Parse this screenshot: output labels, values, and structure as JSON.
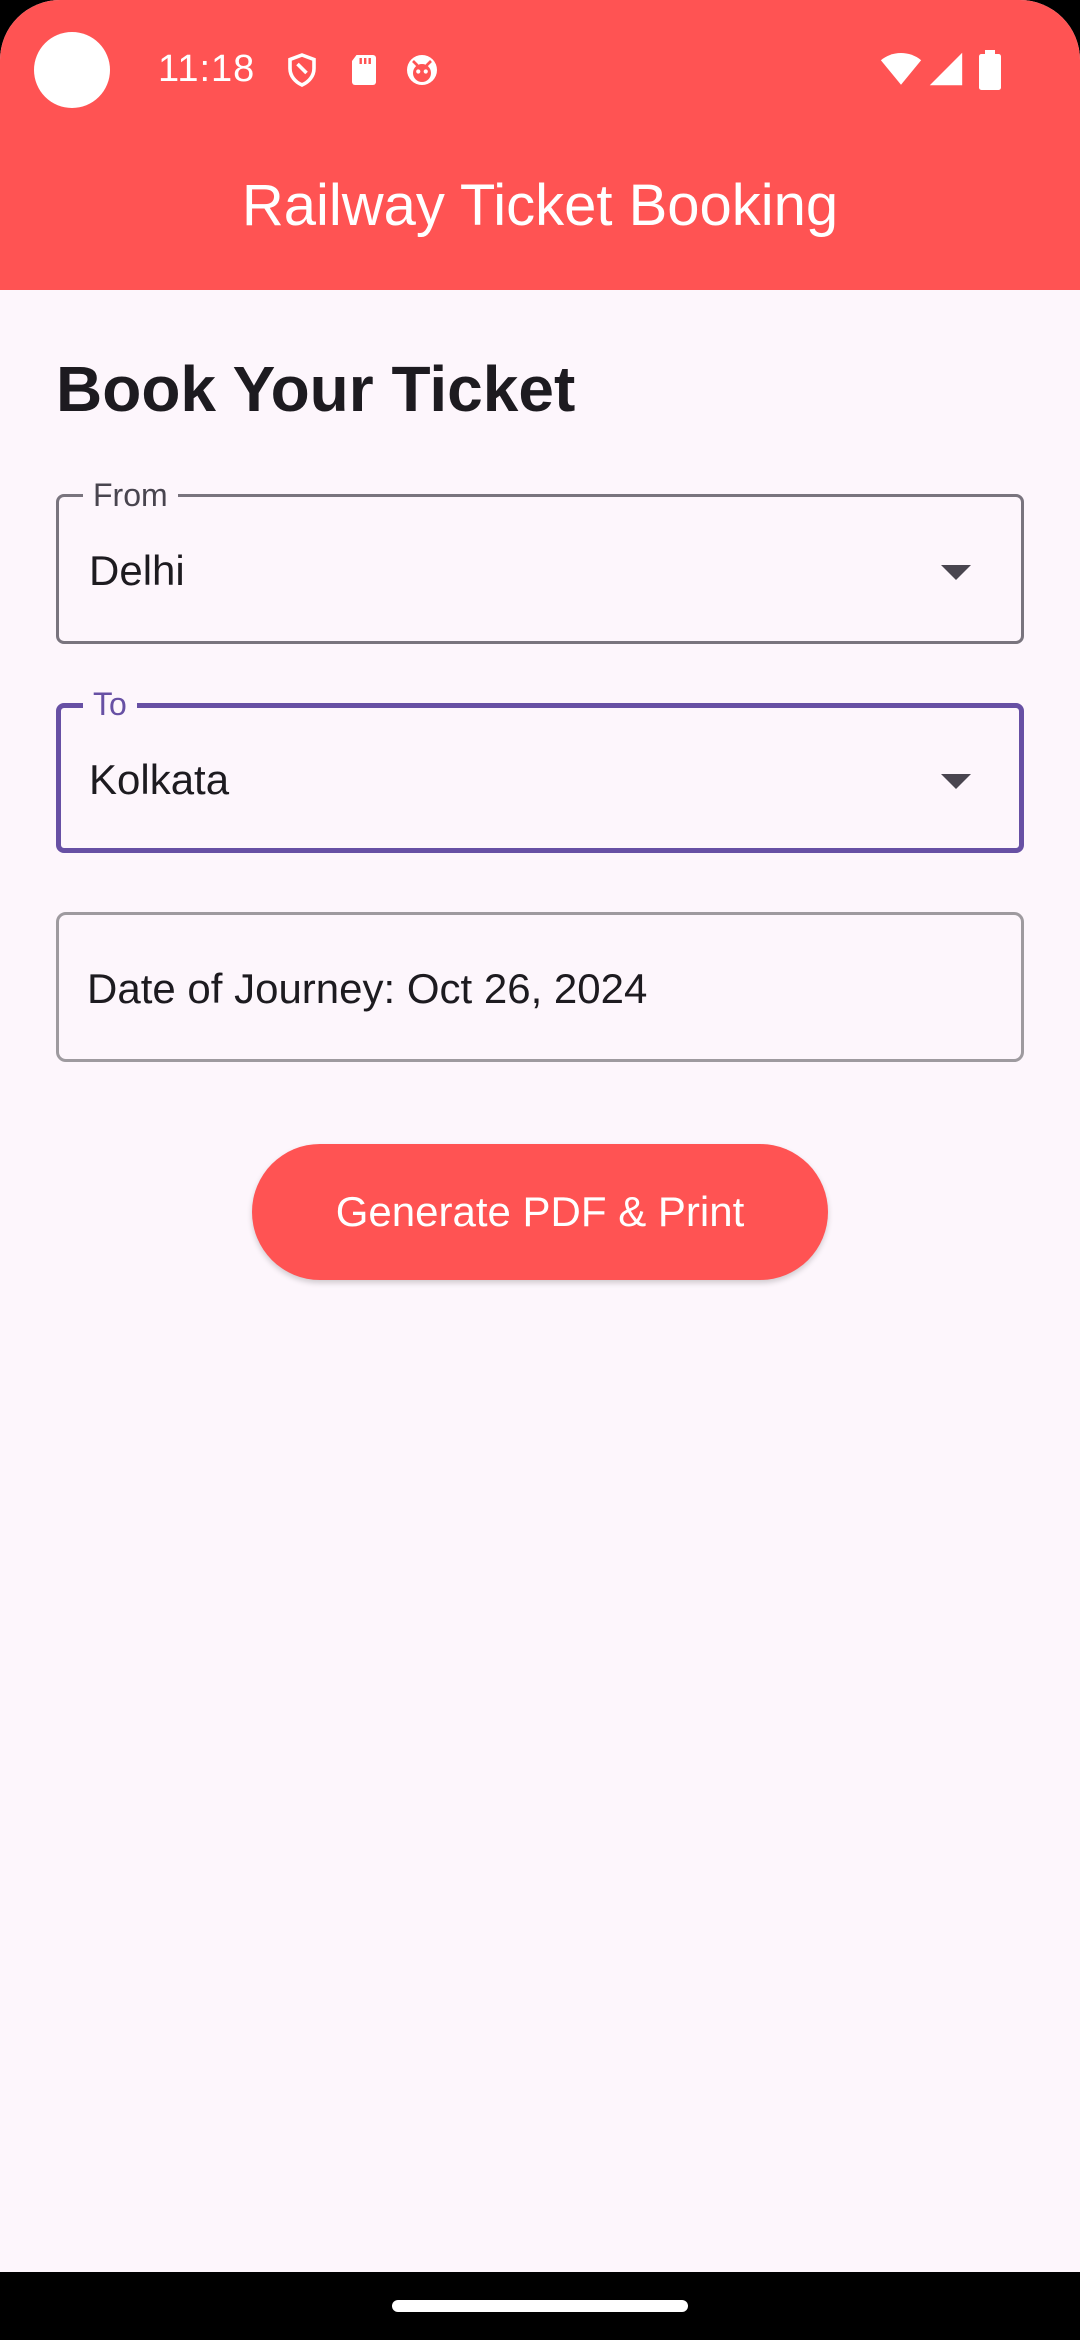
{
  "status_bar": {
    "time": "11:18",
    "left_icons": [
      "shield-icon",
      "sd-card-icon",
      "face-icon"
    ],
    "right_icons": [
      "wifi-icon",
      "signal-icon",
      "battery-icon"
    ]
  },
  "app_bar": {
    "title": "Railway Ticket Booking",
    "color": "#FF5353"
  },
  "form": {
    "heading": "Book Your Ticket",
    "from": {
      "label": "From",
      "value": "Delhi"
    },
    "to": {
      "label": "To",
      "value": "Kolkata"
    },
    "date_field": {
      "text": "Date of Journey: Oct 26, 2024"
    },
    "submit_label": "Generate PDF & Print"
  },
  "colors": {
    "accent": "#FF5353",
    "focus": "#6750A4",
    "background": "#FDF6FC"
  }
}
